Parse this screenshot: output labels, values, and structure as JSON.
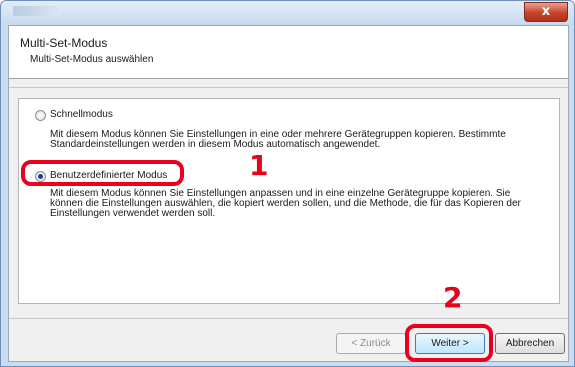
{
  "header": {
    "title": "Multi-Set-Modus",
    "subtitle": "Multi-Set-Modus auswählen"
  },
  "options": [
    {
      "label": "Schnellmodus",
      "selected": false,
      "description": [
        "Mit diesem Modus können Sie Einstellungen in eine oder mehrere Gerätegruppen kopieren. Bestimmte",
        "Standardeinstellungen werden in diesem Modus automatisch angewendet."
      ]
    },
    {
      "label": "Benutzerdefinierter Modus",
      "selected": true,
      "description": [
        "Mit diesem Modus können Sie Einstellungen anpassen und in eine einzelne Gerätegruppe kopieren. Sie",
        "können die Einstellungen auswählen, die kopiert werden sollen, und die Methode, die für das Kopieren der",
        "Einstellungen verwendet werden soll."
      ]
    }
  ],
  "callouts": {
    "step1": "1",
    "step2": "2"
  },
  "buttons": {
    "back": "< Zurück",
    "next": "Weiter >",
    "cancel": "Abbrechen"
  },
  "window": {
    "close_glyph": "x"
  },
  "colors": {
    "callout": "#e8001c",
    "radio_dot": "#1e3d8a"
  }
}
